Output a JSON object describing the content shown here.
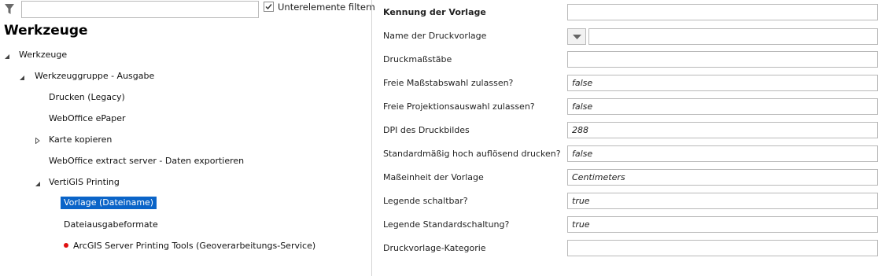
{
  "filter": {
    "value": "",
    "checkbox_label": "Unterelemente filtern",
    "checkbox_checked": true
  },
  "tree": {
    "title": "Werkzeuge",
    "nodes": [
      {
        "label": "Werkzeuge",
        "expander": "expanded"
      },
      {
        "label": "Werkzeuggruppe - Ausgabe",
        "expander": "expanded"
      },
      {
        "label": "Drucken (Legacy)",
        "expander": "none"
      },
      {
        "label": "WebOffice ePaper",
        "expander": "none"
      },
      {
        "label": "Karte kopieren",
        "expander": "collapsed"
      },
      {
        "label": "WebOffice extract server - Daten exportieren",
        "expander": "none"
      },
      {
        "label": "VertiGIS Printing",
        "expander": "expanded"
      },
      {
        "label": "Vorlage (Dateiname)",
        "expander": "none",
        "selected": true
      },
      {
        "label": "Dateiausgabeformate",
        "expander": "none"
      },
      {
        "label": "ArcGIS Server Printing Tools (Geoverarbeitungs-Service)",
        "expander": "none",
        "status": "error-dot"
      }
    ]
  },
  "properties": [
    {
      "label": "Kennung der Vorlage",
      "value": "",
      "bold": true
    },
    {
      "label": "Name der Druckvorlage",
      "value": "",
      "type": "dropdown"
    },
    {
      "label": "Druckmaßstäbe",
      "value": ""
    },
    {
      "label": "Freie Maßstabswahl zulassen?",
      "value": "false"
    },
    {
      "label": "Freie Projektionsauswahl zulassen?",
      "value": "false"
    },
    {
      "label": "DPI des Druckbildes",
      "value": "288"
    },
    {
      "label": "Standardmäßig hoch auflösend drucken?",
      "value": "false"
    },
    {
      "label": "Maßeinheit der Vorlage",
      "value": "Centimeters"
    },
    {
      "label": "Legende schaltbar?",
      "value": "true"
    },
    {
      "label": "Legende Standardschaltung?",
      "value": "true"
    },
    {
      "label": "Druckvorlage-Kategorie",
      "value": ""
    }
  ],
  "colors": {
    "selection": "#0a64c8",
    "error_dot": "#e01010",
    "border": "#b9b9b9"
  }
}
